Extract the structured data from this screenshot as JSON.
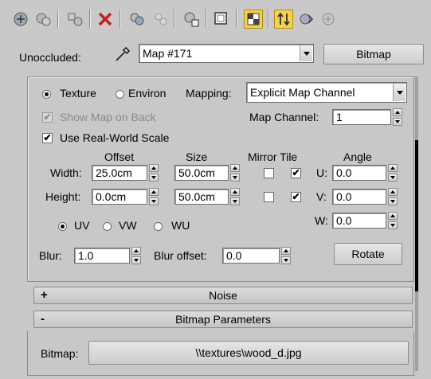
{
  "toolbar": {
    "icons": [
      "get-material-icon",
      "put-to-scene-icon",
      "assign-material-icon",
      "delete-icon",
      "make-unique-icon",
      "put-to-library-icon",
      "material-id-channel-icon",
      "show-map-in-viewport-icon",
      "show-end-result-icon",
      "go-to-parent-icon",
      "go-forward-to-sibling-icon",
      "navigator-icon"
    ]
  },
  "header": {
    "unoccluded_label": "Unoccluded:",
    "map_name": "Map #171",
    "map_type_button": "Bitmap"
  },
  "coords": {
    "texture_label": "Texture",
    "environ_label": "Environ",
    "texture_selected": true,
    "mapping_label": "Mapping:",
    "mapping_value": "Explicit Map Channel",
    "show_map_on_back_label": "Show Map on Back",
    "show_map_on_back_checked": true,
    "map_channel_label": "Map Channel:",
    "map_channel_value": "1",
    "use_real_world_label": "Use Real-World Scale",
    "use_real_world_checked": true,
    "offset_header": "Offset",
    "size_header": "Size",
    "mirror_tile_header": "Mirror Tile",
    "angle_header": "Angle",
    "width_label": "Width:",
    "height_label": "Height:",
    "width_offset": "25.0cm",
    "width_size": "50.0cm",
    "height_offset": "0.0cm",
    "height_size": "50.0cm",
    "width_mirror": false,
    "width_tile": true,
    "height_mirror": false,
    "height_tile": true,
    "u_label": "U:",
    "v_label": "V:",
    "w_label": "W:",
    "u_angle": "0.0",
    "v_angle": "0.0",
    "w_angle": "0.0",
    "uv_label": "UV",
    "vw_label": "VW",
    "wu_label": "WU",
    "uv_selected": true,
    "blur_label": "Blur:",
    "blur_value": "1.0",
    "blur_offset_label": "Blur offset:",
    "blur_offset_value": "0.0",
    "rotate_button": "Rotate"
  },
  "rollouts": {
    "noise_sign": "+",
    "noise_label": "Noise",
    "bitmap_params_sign": "-",
    "bitmap_params_label": "Bitmap Parameters"
  },
  "bitmap": {
    "label": "Bitmap:",
    "path": "\\\\textures\\wood_d.jpg"
  },
  "colors": {
    "highlight": "#f4d24a",
    "panel_bg": "#c8c8c8"
  }
}
